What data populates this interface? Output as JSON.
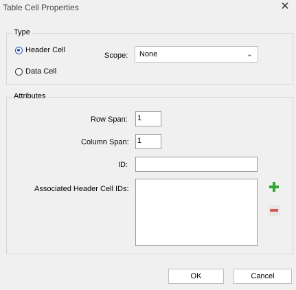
{
  "window": {
    "title": "Table Cell Properties",
    "close_icon": "close-icon"
  },
  "type_group": {
    "title": "Type",
    "options": [
      {
        "label": "Header Cell",
        "selected": true
      },
      {
        "label": "Data Cell",
        "selected": false
      }
    ],
    "scope_label": "Scope:",
    "scope_value": "None",
    "dropdown_icon": "chevron-down-icon"
  },
  "attributes_group": {
    "title": "Attributes",
    "row_span_label": "Row Span:",
    "row_span_value": "1",
    "column_span_label": "Column Span:",
    "column_span_value": "1",
    "id_label": "ID:",
    "id_value": "",
    "associated_label": "Associated Header Cell IDs:",
    "add_icon": "plus-icon",
    "remove_icon": "minus-icon"
  },
  "buttons": {
    "ok": "OK",
    "cancel": "Cancel"
  },
  "colors": {
    "radio_accent": "#1a4bb5",
    "add_green": "#2fa82f",
    "remove_red": "#d9534f"
  }
}
